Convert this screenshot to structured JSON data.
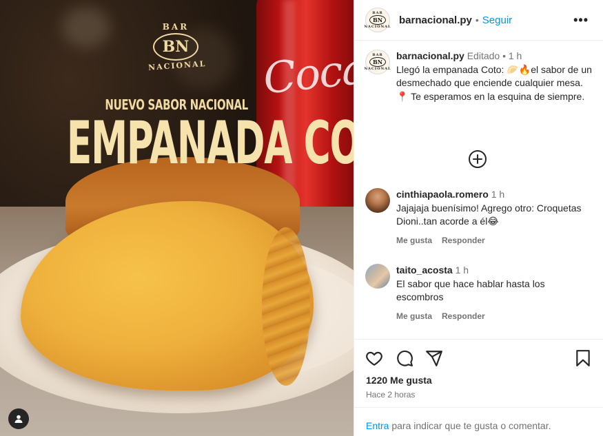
{
  "media": {
    "brand_top": "BAR",
    "brand_initials": "BN",
    "brand_bottom": "NACIONAL",
    "subtitle": "NUEVO SABOR NACIONAL",
    "title": "EMPANADA COTO",
    "can_text": "Coca"
  },
  "header": {
    "username": "barnacional.py",
    "separator": "•",
    "follow_label": "Seguir",
    "more_label": "•••",
    "avatar_top": "BAR",
    "avatar_initials": "BN",
    "avatar_bottom": "NACIONAL"
  },
  "caption": {
    "username": "barnacional.py",
    "edited": "Editado",
    "separator": "•",
    "time": "1 h",
    "text_line1": "Llegó la empanada Coto: 🥟🔥el sabor de un desmechado que enciende cualquier mesa.",
    "text_line2": "📍 Te esperamos en la esquina de siempre."
  },
  "comments": [
    {
      "username": "cinthiapaola.romero",
      "time": "1 h",
      "text": "Jajajaja buenísimo! Agrego otro: Croquetas Dioni..tan acorde a él😂",
      "like_label": "Me gusta",
      "reply_label": "Responder"
    },
    {
      "username": "taito_acosta",
      "time": "1 h",
      "text": "El sabor que hace hablar hasta los escombros",
      "like_label": "Me gusta",
      "reply_label": "Responder"
    }
  ],
  "footer": {
    "likes_count": "1220 Me gusta",
    "posted_time": "Hace 2 horas",
    "login_link": "Entra",
    "login_text": " para indicar que te gusta o comentar."
  },
  "icons": [
    "heart-icon",
    "comment-icon",
    "share-icon",
    "bookmark-icon",
    "plus-circle-icon",
    "user-tag-icon",
    "more-icon"
  ],
  "colors": {
    "link": "#0095f6",
    "text": "#262626",
    "muted": "#737373",
    "brand_gold": "#f0d9a3"
  }
}
